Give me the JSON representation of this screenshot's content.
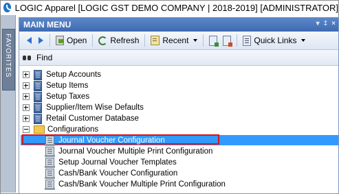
{
  "window": {
    "title": "LOGIC Apparel [LOGIC GST DEMO COMPANY | 2018-2019] [ADMINISTRATOR]"
  },
  "favorites": {
    "label": "FAVORITES"
  },
  "main_menu": {
    "title": "MAIN MENU",
    "header_controls": [
      "▾",
      "‡",
      "×"
    ]
  },
  "toolbar": {
    "open_label": "Open",
    "refresh_label": "Refresh",
    "recent_label": "Recent",
    "quick_links_label": "Quick Links"
  },
  "find": {
    "label": "Find"
  },
  "tree": {
    "items": [
      {
        "label": "Setup Accounts",
        "expander": "plus"
      },
      {
        "label": "Setup Items",
        "expander": "plus"
      },
      {
        "label": "Setup Taxes",
        "expander": "plus"
      },
      {
        "label": "Supplier/Item Wise Defaults",
        "expander": "plus"
      },
      {
        "label": "Retail Customer Database",
        "expander": "plus"
      },
      {
        "label": "Configurations",
        "expander": "minus"
      }
    ],
    "children": [
      {
        "label": "Journal Voucher Configuration",
        "selected": true
      },
      {
        "label": "Journal Voucher Multiple Print Configuration",
        "selected": false
      },
      {
        "label": "Setup Journal Voucher Templates",
        "selected": false
      },
      {
        "label": "Cash/Bank Voucher Configuration",
        "selected": false
      },
      {
        "label": "Cash/Bank Voucher Multiple Print Configuration",
        "selected": false
      }
    ]
  },
  "colors": {
    "header": "#4a77bf",
    "selection": "#3399ff",
    "highlight_outline": "#d0161d"
  }
}
